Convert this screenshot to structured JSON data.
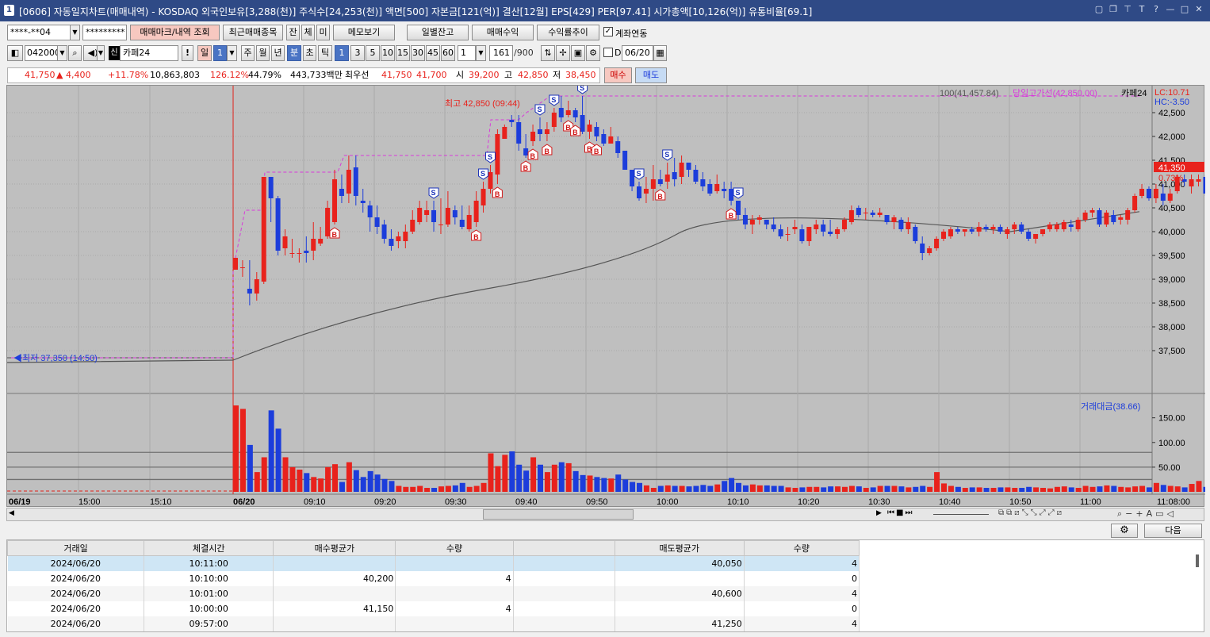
{
  "window": {
    "number": "1",
    "title": "[0606] 자동일지차트(매매내역) - KOSDAQ 외국인보유[3,288(천)] 주식수[24,253(천)] 액면[500] 자본금[121(억)] 결산[12월] EPS[429] PER[97.41] 시가총액[10,126(억)] 유통비율[69.1]"
  },
  "toolbar1": {
    "account": "****-**04",
    "password": "*********",
    "btn_mark": "매매마크/내역 조회",
    "btn_recent": "최근매매종목",
    "btn_jan": "잔",
    "btn_che": "체",
    "btn_mi": "미",
    "btn_memo": "메모보기",
    "btn_daily": "일별잔고",
    "btn_profit": "매매수익",
    "btn_return": "수익률추이",
    "link_label": "계좌연동"
  },
  "toolbar2": {
    "code": "042000",
    "sin": "신",
    "name": "카페24",
    "warn": "!",
    "periods": [
      "일",
      "1",
      "주",
      "월",
      "년",
      "분",
      "초",
      "틱"
    ],
    "minutes": [
      "1",
      "3",
      "5",
      "10",
      "15",
      "30",
      "45",
      "60"
    ],
    "interval": "1",
    "count": "161",
    "count_max": "/900",
    "d_label": "D",
    "date": "06/20"
  },
  "priceBar": {
    "price": "41,750",
    "change": "▲ 4,400",
    "rate": "+11.78%",
    "volume": "10,863,803",
    "vol_ratio": "126.12%",
    "turnover": "44.79%",
    "amount": "443,733백만",
    "best_label": "최우선",
    "ask": "41,750",
    "bid": "41,700",
    "open_label": "시",
    "open": "39,200",
    "high_label": "고",
    "high": "42,850",
    "low_label": "저",
    "low": "38,450",
    "buy": "매수",
    "sell": "매도"
  },
  "chart": {
    "ma_label": "100(41,457.84)",
    "high_line_label": "당일고가선(42,850.00)",
    "stock_label": "카페24",
    "lc": "LC:10.71",
    "hc": "HC:-3.50",
    "max_label": "최고 42,850 (09:44)",
    "min_label": "최저 37,350 (14:50)",
    "current_price": "41,350",
    "current_rate": "0.73%",
    "vol_label": "거래대금(38.66)",
    "y_ticks": [
      "42,500",
      "42,000",
      "41,500",
      "41,000",
      "40,500",
      "40,000",
      "39,500",
      "39,000",
      "38,500",
      "38,000",
      "37,500"
    ],
    "vol_ticks": [
      "150.00",
      "100.00",
      "50.00"
    ],
    "x_ticks": [
      "06/19",
      "15:00",
      "15:10",
      "06/20",
      "09:10",
      "09:20",
      "09:30",
      "09:40",
      "09:50",
      "10:00",
      "10:10",
      "10:20",
      "10:30",
      "10:40",
      "10:50",
      "11:00",
      "11:08:00"
    ]
  },
  "chart_data": {
    "type": "candlestick",
    "ylim": [
      37100,
      42850
    ],
    "prev_day_close": 37350,
    "ohlc": [
      [
        39200,
        39450,
        39200,
        39450
      ],
      [
        39250,
        39400,
        39050,
        39250
      ],
      [
        38800,
        39400,
        38450,
        38700
      ],
      [
        38700,
        39150,
        38550,
        39000
      ],
      [
        38950,
        41150,
        38900,
        41150
      ],
      [
        41150,
        41150,
        40200,
        40700
      ],
      [
        40700,
        40750,
        39500,
        39600
      ],
      [
        39650,
        40050,
        39500,
        39900
      ],
      [
        39550,
        39850,
        39450,
        39550
      ],
      [
        39550,
        39650,
        39350,
        39550
      ],
      [
        39600,
        39900,
        39350,
        39550
      ],
      [
        39600,
        40200,
        39400,
        39850
      ],
      [
        39750,
        40100,
        39700,
        39850
      ],
      [
        39900,
        40650,
        39850,
        40500
      ],
      [
        40200,
        41300,
        40150,
        41100
      ],
      [
        40900,
        41200,
        40600,
        40750
      ],
      [
        40800,
        41600,
        40600,
        41300
      ],
      [
        41350,
        41600,
        40550,
        40750
      ],
      [
        40650,
        40900,
        40400,
        40600
      ],
      [
        40550,
        40650,
        40000,
        40300
      ],
      [
        40300,
        40550,
        39950,
        40100
      ],
      [
        40150,
        40250,
        39750,
        39850
      ],
      [
        39850,
        40050,
        39600,
        39700
      ],
      [
        39800,
        40000,
        39650,
        39900
      ],
      [
        39800,
        40150,
        39650,
        40000
      ],
      [
        40000,
        40450,
        39950,
        40250
      ],
      [
        40200,
        40650,
        40150,
        40500
      ],
      [
        40350,
        40650,
        40200,
        40450
      ],
      [
        40450,
        40650,
        40000,
        40200
      ],
      [
        40150,
        40700,
        39950,
        40150
      ],
      [
        40150,
        40850,
        40100,
        40500
      ],
      [
        40450,
        40550,
        40150,
        40300
      ],
      [
        40250,
        40550,
        40050,
        40100
      ],
      [
        40050,
        40550,
        40000,
        40350
      ],
      [
        40200,
        40850,
        40100,
        40650
      ],
      [
        40550,
        41050,
        40400,
        40900
      ],
      [
        40900,
        41400,
        40800,
        41250
      ],
      [
        41200,
        42150,
        41000,
        42050
      ],
      [
        41950,
        42250,
        41950,
        42200
      ],
      [
        42350,
        42450,
        42200,
        42300
      ],
      [
        42300,
        42450,
        41700,
        41850
      ],
      [
        41750,
        42050,
        41550,
        41600
      ],
      [
        41900,
        42250,
        41800,
        42100
      ],
      [
        42150,
        42400,
        41900,
        42050
      ],
      [
        42050,
        42300,
        41900,
        42150
      ],
      [
        42200,
        42600,
        42100,
        42500
      ],
      [
        42600,
        42850,
        42300,
        42400
      ],
      [
        42450,
        42750,
        42400,
        42550
      ],
      [
        42550,
        42600,
        42300,
        42400
      ],
      [
        42450,
        42850,
        42050,
        42100
      ],
      [
        42100,
        42350,
        41950,
        42250
      ],
      [
        42200,
        42300,
        41900,
        42000
      ],
      [
        42050,
        42150,
        41800,
        41850
      ],
      [
        41850,
        42200,
        41850,
        42000
      ],
      [
        41900,
        42000,
        41550,
        41650
      ],
      [
        41700,
        41700,
        41300,
        41300
      ],
      [
        41300,
        41300,
        40850,
        40950
      ],
      [
        40950,
        41050,
        40650,
        40700
      ],
      [
        40800,
        41150,
        40600,
        40900
      ],
      [
        40900,
        41400,
        40650,
        41100
      ],
      [
        41100,
        41300,
        40950,
        41000
      ],
      [
        41050,
        41450,
        40900,
        41200
      ],
      [
        41250,
        41550,
        40950,
        41100
      ],
      [
        41150,
        41600,
        41000,
        41450
      ],
      [
        41450,
        41450,
        41150,
        41300
      ],
      [
        41300,
        41400,
        41000,
        41050
      ],
      [
        41100,
        41250,
        40850,
        40950
      ],
      [
        41000,
        41100,
        40750,
        40800
      ],
      [
        40850,
        41200,
        40800,
        41000
      ],
      [
        40900,
        41050,
        40700,
        40850
      ],
      [
        40900,
        41050,
        40550,
        40650
      ],
      [
        40650,
        40650,
        40250,
        40350
      ],
      [
        40350,
        40500,
        40050,
        40150
      ],
      [
        40150,
        40350,
        39950,
        40250
      ],
      [
        40250,
        40350,
        40150,
        40300
      ],
      [
        40250,
        40250,
        40050,
        40150
      ],
      [
        40150,
        40300,
        40000,
        40050
      ],
      [
        40050,
        40150,
        39850,
        39900
      ],
      [
        39950,
        40100,
        39800,
        39950
      ],
      [
        40050,
        40250,
        39950,
        40100
      ],
      [
        40050,
        40150,
        39750,
        39800
      ],
      [
        39800,
        40100,
        39700,
        40100
      ],
      [
        40050,
        40250,
        39950,
        40150
      ],
      [
        40150,
        40250,
        39900,
        40000
      ],
      [
        40000,
        40250,
        39900,
        39950
      ],
      [
        39950,
        40100,
        39850,
        40050
      ],
      [
        40050,
        40300,
        40000,
        40250
      ],
      [
        40200,
        40550,
        40150,
        40450
      ],
      [
        40500,
        40550,
        40300,
        40350
      ],
      [
        40400,
        40500,
        40250,
        40400
      ],
      [
        40400,
        40450,
        40300,
        40350
      ],
      [
        40350,
        40500,
        40300,
        40400
      ],
      [
        40350,
        40350,
        40150,
        40200
      ],
      [
        40200,
        40350,
        40050,
        40300
      ],
      [
        40250,
        40300,
        40000,
        40050
      ],
      [
        40050,
        40300,
        39950,
        40200
      ],
      [
        40100,
        40150,
        39750,
        39800
      ],
      [
        39750,
        39900,
        39400,
        39550
      ],
      [
        39550,
        39700,
        39500,
        39650
      ],
      [
        39650,
        39900,
        39600,
        39850
      ],
      [
        39850,
        40050,
        39800,
        40000
      ],
      [
        39900,
        40100,
        39850,
        40050
      ],
      [
        40050,
        40100,
        39950,
        40000
      ],
      [
        40000,
        40050,
        39900,
        40050
      ],
      [
        40050,
        40100,
        39950,
        40000
      ],
      [
        40000,
        40200,
        39900,
        40100
      ],
      [
        40100,
        40150,
        40000,
        40050
      ],
      [
        40050,
        40150,
        39950,
        40100
      ],
      [
        40100,
        40150,
        39950,
        40000
      ],
      [
        39950,
        40100,
        39850,
        40050
      ],
      [
        40050,
        40200,
        39950,
        40150
      ],
      [
        40150,
        40200,
        39950,
        40000
      ],
      [
        40000,
        40050,
        39800,
        39850
      ],
      [
        39850,
        39950,
        39750,
        39950
      ],
      [
        39950,
        40050,
        39900,
        40050
      ],
      [
        40050,
        40200,
        40000,
        40150
      ],
      [
        40050,
        40200,
        40000,
        40150
      ],
      [
        40050,
        40250,
        40000,
        40200
      ],
      [
        40150,
        40250,
        40000,
        40100
      ],
      [
        40050,
        40300,
        40000,
        40250
      ],
      [
        40250,
        40450,
        40200,
        40400
      ],
      [
        40400,
        40500,
        40300,
        40450
      ],
      [
        40450,
        40500,
        40100,
        40150
      ],
      [
        40150,
        40450,
        40100,
        40400
      ],
      [
        40350,
        40450,
        40150,
        40200
      ],
      [
        40250,
        40350,
        40150,
        40300
      ],
      [
        40250,
        40500,
        40150,
        40450
      ],
      [
        40450,
        40800,
        40400,
        40750
      ],
      [
        40750,
        41000,
        40700,
        40900
      ],
      [
        40900,
        40950,
        40650,
        40700
      ],
      [
        40700,
        41000,
        40600,
        40900
      ],
      [
        40800,
        41000,
        40550,
        40650
      ],
      [
        40650,
        40900,
        40600,
        40800
      ],
      [
        40850,
        41200,
        40800,
        41150
      ],
      [
        41100,
        41200,
        40950,
        41050
      ],
      [
        40950,
        41200,
        40800,
        41100
      ],
      [
        41050,
        41200,
        40950,
        41100
      ],
      [
        41150,
        41200,
        40750,
        40800
      ],
      [
        40800,
        40900,
        40550,
        40600
      ],
      [
        40600,
        40800,
        40550,
        40750
      ],
      [
        40800,
        40950,
        40700,
        40900
      ],
      [
        40900,
        41000,
        40800,
        40850
      ],
      [
        40850,
        41100,
        40800,
        41000
      ],
      [
        40950,
        41150,
        40850,
        41050
      ],
      [
        41000,
        41450,
        40950,
        41250
      ],
      [
        41250,
        41350,
        41100,
        41150
      ],
      [
        41150,
        41300,
        41050,
        41200
      ],
      [
        41250,
        41450,
        41100,
        41350
      ],
      [
        41350,
        41400,
        41100,
        41150
      ],
      [
        41150,
        41350,
        40850,
        40900
      ],
      [
        40900,
        41100,
        40800,
        41100
      ],
      [
        41050,
        41250,
        40950,
        41200
      ],
      [
        41200,
        41250,
        41050,
        41100
      ],
      [
        41150,
        41300,
        40950,
        41000
      ],
      [
        41000,
        41450,
        40950,
        41300
      ]
    ],
    "volume": [
      175,
      168,
      95,
      40,
      70,
      165,
      128,
      70,
      50,
      45,
      38,
      30,
      27,
      50,
      56,
      20,
      60,
      44,
      30,
      42,
      35,
      26,
      22,
      12,
      10,
      10,
      12,
      8,
      8,
      11,
      12,
      13,
      18,
      10,
      12,
      18,
      78,
      52,
      75,
      82,
      55,
      43,
      70,
      55,
      40,
      55,
      60,
      58,
      42,
      34,
      33,
      30,
      28,
      27,
      35,
      25,
      20,
      18,
      13,
      8,
      12,
      13,
      12,
      12,
      11,
      12,
      14,
      12,
      15,
      22,
      28,
      18,
      13,
      15,
      13,
      13,
      12,
      12,
      9,
      8,
      9,
      10,
      10,
      9,
      11,
      11,
      10,
      12,
      11,
      8,
      9,
      12,
      12,
      12,
      11,
      9,
      10,
      12,
      10,
      40,
      17,
      12,
      10,
      8,
      9,
      9,
      8,
      8,
      9,
      9,
      8,
      8,
      10,
      9,
      8,
      7,
      10,
      11,
      9,
      8,
      12,
      10,
      11,
      13,
      12,
      10,
      9,
      11,
      12,
      9,
      18,
      14,
      12,
      11,
      9,
      16,
      22,
      10,
      13,
      8,
      12,
      12,
      11,
      14,
      10,
      14,
      10,
      12,
      11,
      10,
      8,
      9,
      12,
      12,
      8,
      8,
      9,
      9,
      8,
      10,
      18
    ],
    "ma100": [
      38560,
      39200,
      40640,
      41250
    ],
    "trades": [
      {
        "t": "09:14",
        "side": "B"
      },
      {
        "t": "09:28",
        "side": "S"
      },
      {
        "t": "09:34",
        "side": "B"
      },
      {
        "t": "09:35",
        "side": "S"
      },
      {
        "t": "09:36",
        "side": "S"
      },
      {
        "t": "09:37",
        "side": "B"
      },
      {
        "t": "09:41",
        "side": "B"
      },
      {
        "t": "09:42",
        "side": "B"
      },
      {
        "t": "09:43",
        "side": "S"
      },
      {
        "t": "09:44",
        "side": "B"
      },
      {
        "t": "09:45",
        "side": "S"
      },
      {
        "t": "09:47",
        "side": "B"
      },
      {
        "t": "09:48",
        "side": "B"
      },
      {
        "t": "09:49",
        "side": "S"
      },
      {
        "t": "09:50",
        "side": "B"
      },
      {
        "t": "09:51",
        "side": "B"
      },
      {
        "t": "09:57",
        "side": "S"
      },
      {
        "t": "10:00",
        "side": "B"
      },
      {
        "t": "10:01",
        "side": "S"
      },
      {
        "t": "10:10",
        "side": "B"
      },
      {
        "t": "10:11",
        "side": "S"
      }
    ]
  },
  "bottom": {
    "settings_icon": "gear-icon",
    "next": "다음"
  },
  "grid": {
    "headers": [
      "거래일",
      "체결시간",
      "매수평균가",
      "수량",
      "",
      "매도평균가",
      "수량"
    ],
    "rows": [
      [
        "2024/06/20",
        "10:11:00",
        "",
        "",
        "",
        "40,050",
        "4"
      ],
      [
        "2024/06/20",
        "10:10:00",
        "40,200",
        "4",
        "",
        "",
        "0"
      ],
      [
        "2024/06/20",
        "10:01:00",
        "",
        "",
        "",
        "40,600",
        "4"
      ],
      [
        "2024/06/20",
        "10:00:00",
        "41,150",
        "4",
        "",
        "",
        "0"
      ],
      [
        "2024/06/20",
        "09:57:00",
        "",
        "",
        "",
        "41,250",
        "4"
      ]
    ]
  },
  "colors": {
    "up": "#e8221c",
    "down": "#1c3ddb",
    "title_bg": "#2f4a86",
    "high_line": "#d93adb"
  }
}
